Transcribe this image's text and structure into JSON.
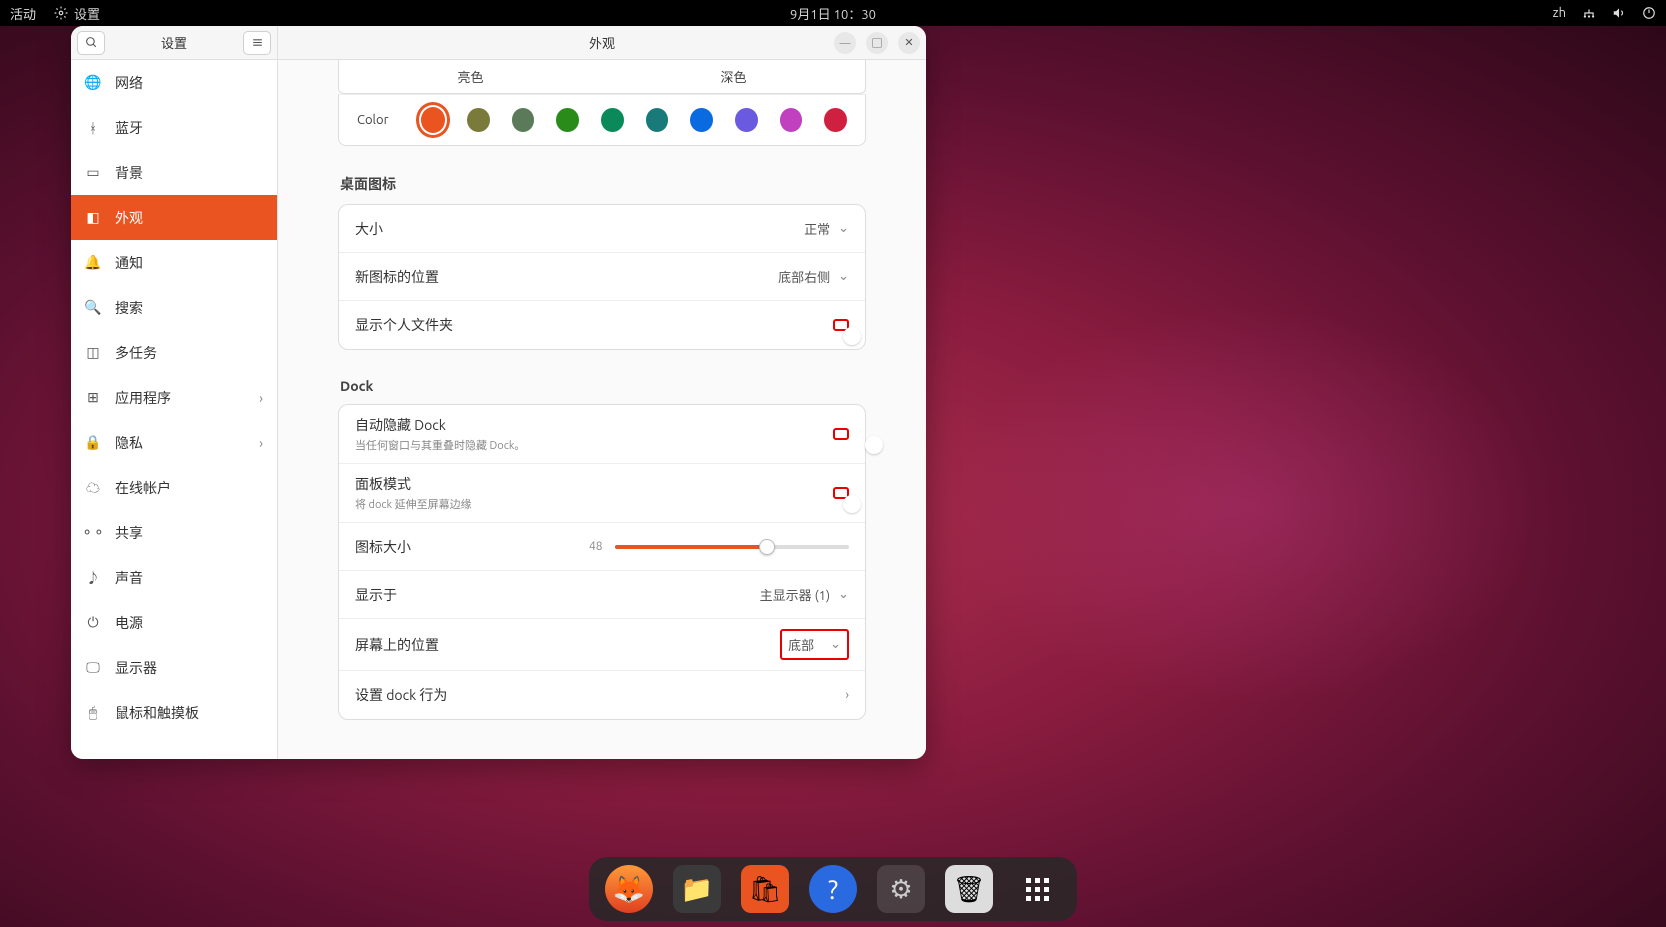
{
  "topbar": {
    "activities": "活动",
    "app_indicator": "设置",
    "datetime": "9月1日 10：30",
    "input_method": "zh"
  },
  "window": {
    "sidebar_title": "设置",
    "main_title": "外观"
  },
  "sidebar": {
    "items": [
      {
        "icon": "globe",
        "label": "网络"
      },
      {
        "icon": "bluetooth",
        "label": "蓝牙"
      },
      {
        "icon": "picture",
        "label": "背景"
      },
      {
        "icon": "appearance",
        "label": "外观",
        "active": true
      },
      {
        "icon": "bell",
        "label": "通知"
      },
      {
        "icon": "search",
        "label": "搜索"
      },
      {
        "icon": "windows",
        "label": "多任务"
      },
      {
        "icon": "grid",
        "label": "应用程序",
        "chevron": true
      },
      {
        "icon": "lock",
        "label": "隐私",
        "chevron": true
      },
      {
        "icon": "cloud",
        "label": "在线帐户"
      },
      {
        "icon": "share",
        "label": "共享"
      },
      {
        "icon": "music",
        "label": "声音"
      },
      {
        "icon": "power",
        "label": "电源"
      },
      {
        "icon": "display",
        "label": "显示器"
      },
      {
        "icon": "mouse",
        "label": "鼠标和触摸板"
      }
    ]
  },
  "appearance": {
    "theme_light": "亮色",
    "theme_dark": "深色",
    "color_label": "Color",
    "colors": [
      "#e95420",
      "#7a7a3a",
      "#5a7a5a",
      "#2a8a1a",
      "#0a8a5a",
      "#1a7a7a",
      "#0a6ae0",
      "#6a5ae0",
      "#c040c0",
      "#d02040"
    ],
    "selected_color_index": 0
  },
  "desktop_icons": {
    "title": "桌面图标",
    "size_label": "大小",
    "size_value": "正常",
    "new_pos_label": "新图标的位置",
    "new_pos_value": "底部右侧",
    "show_home_label": "显示个人文件夹",
    "show_home_on": false
  },
  "dock_section": {
    "title": "Dock",
    "autohide_label": "自动隐藏 Dock",
    "autohide_sub": "当任何窗口与其重叠时隐藏 Dock。",
    "autohide_on": true,
    "panel_label": "面板模式",
    "panel_sub": "将 dock 延伸至屏幕边缘",
    "panel_on": false,
    "icon_size_label": "图标大小",
    "icon_size_value": "48",
    "show_on_label": "显示于",
    "show_on_value": "主显示器 (1)",
    "position_label": "屏幕上的位置",
    "position_value": "底部",
    "behavior_label": "设置 dock 行为"
  }
}
